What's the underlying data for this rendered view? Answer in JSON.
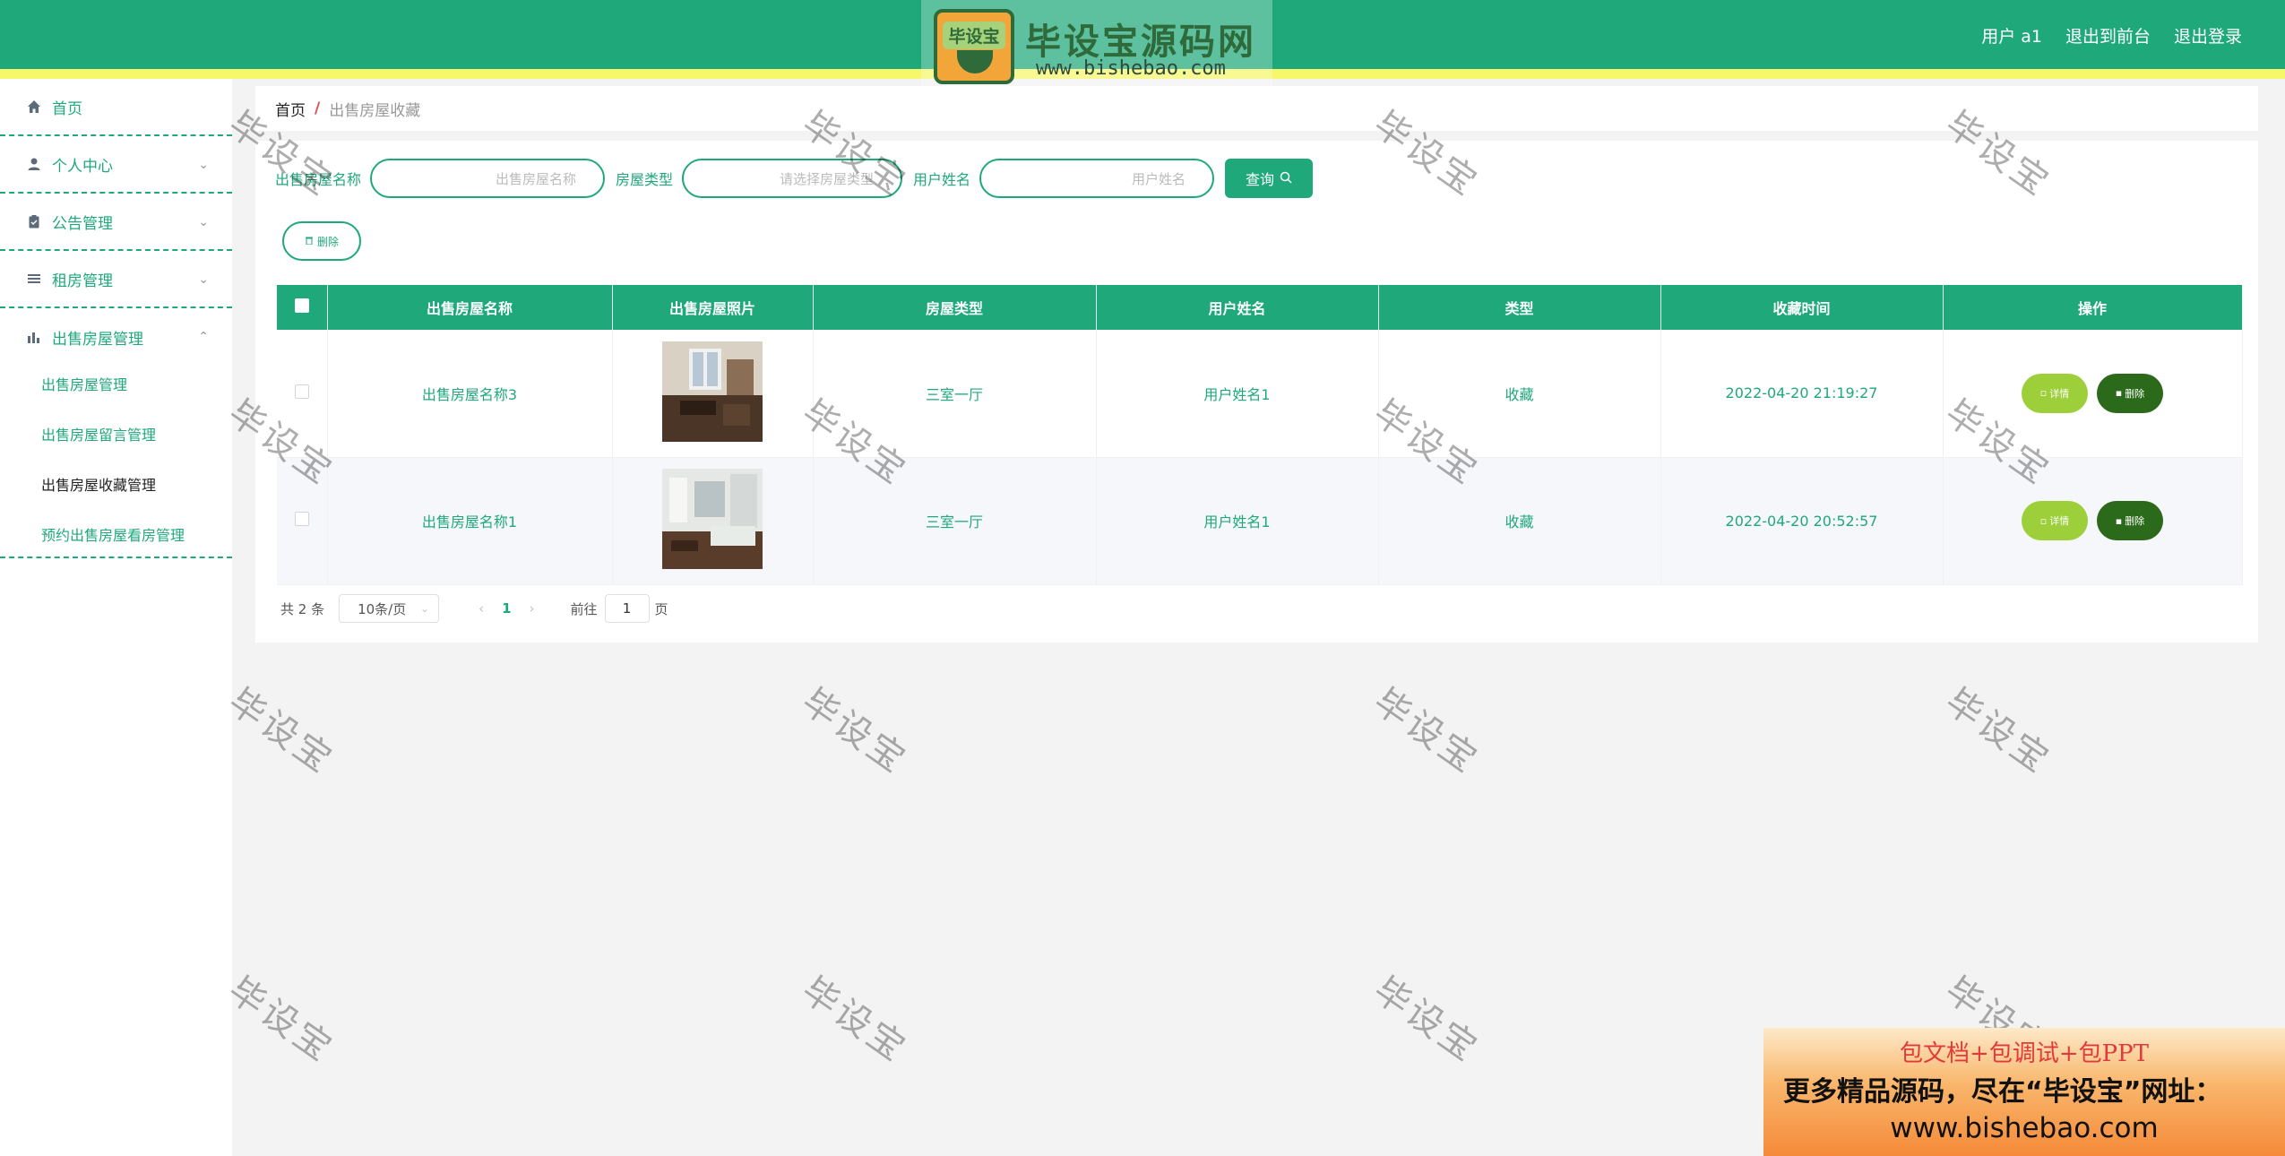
{
  "header": {
    "logo_badge": "毕设宝",
    "logo_title": "毕设宝源码网",
    "logo_url": "www.bishebao.com",
    "user_label": "用户 a1",
    "front_label": "退出到前台",
    "logout_label": "退出登录"
  },
  "sidebar": {
    "items": [
      {
        "label": "首页",
        "icon": "home-icon"
      },
      {
        "label": "个人中心",
        "icon": "user-icon"
      },
      {
        "label": "公告管理",
        "icon": "clipboard-icon"
      },
      {
        "label": "租房管理",
        "icon": "list-icon"
      },
      {
        "label": "出售房屋管理",
        "icon": "bar-chart-icon"
      }
    ],
    "submenu": [
      {
        "label": "出售房屋管理"
      },
      {
        "label": "出售房屋留言管理"
      },
      {
        "label": "出售房屋收藏管理"
      },
      {
        "label": "预约出售房屋看房管理"
      }
    ]
  },
  "breadcrumb": {
    "home": "首页",
    "separator": "/",
    "current": "出售房屋收藏"
  },
  "search": {
    "name_label": "出售房屋名称",
    "name_placeholder": "出售房屋名称",
    "type_label": "房屋类型",
    "type_placeholder": "请选择房屋类型",
    "user_label": "用户姓名",
    "user_placeholder": "用户姓名",
    "query_label": "查询"
  },
  "toolbar": {
    "delete_label": "删除"
  },
  "table": {
    "columns": [
      "出售房屋名称",
      "出售房屋照片",
      "房屋类型",
      "用户姓名",
      "类型",
      "收藏时间",
      "操作"
    ],
    "rows": [
      {
        "name": "出售房屋名称3",
        "house_type": "三室一厅",
        "user": "用户姓名1",
        "kind": "收藏",
        "time": "2022-04-20 21:19:27"
      },
      {
        "name": "出售房屋名称1",
        "house_type": "三室一厅",
        "user": "用户姓名1",
        "kind": "收藏",
        "time": "2022-04-20 20:52:57"
      }
    ],
    "detail_label": "详情",
    "delete_label": "删除"
  },
  "pagination": {
    "total": "共 2 条",
    "page_size": "10条/页",
    "current_page": "1",
    "goto_prefix": "前往",
    "goto_value": "1",
    "goto_suffix": "页"
  },
  "watermark": "毕设宝",
  "ad": {
    "line1": "包文档+包调试+包PPT",
    "line2": "更多精品源码，尽在“毕设宝”网址：",
    "line3": "www.bishebao.com"
  },
  "colors": {
    "primary": "#1fa97a",
    "stripe": "#f7f76a",
    "detail_button": "#9ccf3a",
    "delete_button": "#2b6a1a"
  }
}
